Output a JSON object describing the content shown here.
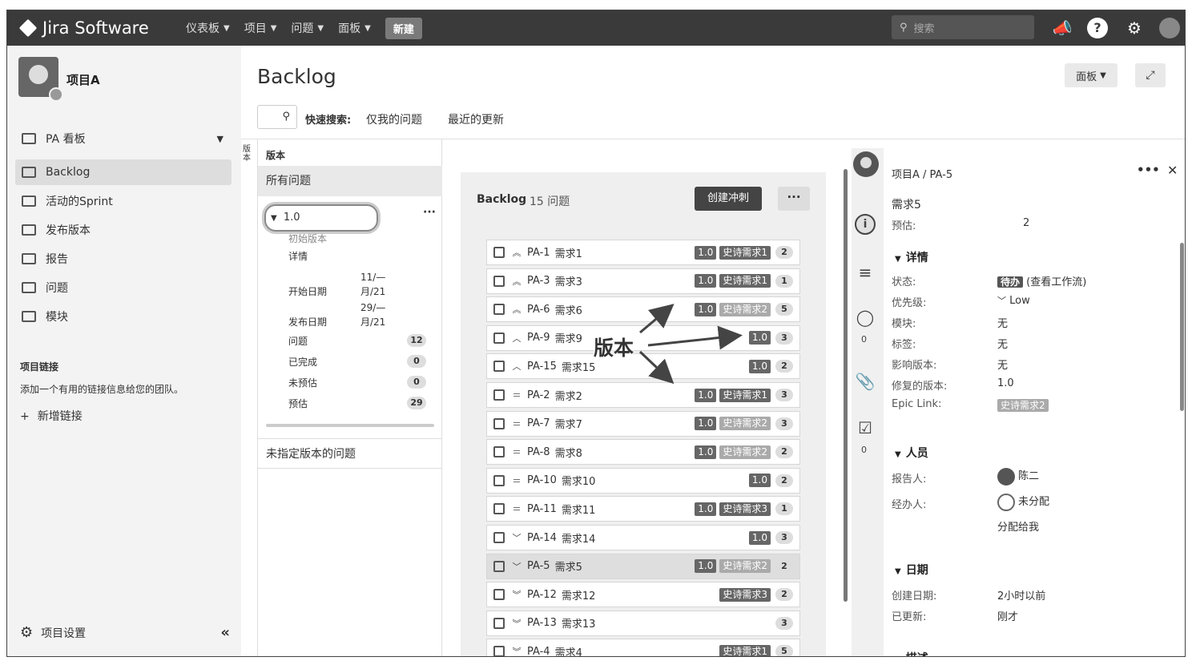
{
  "topbar": {
    "logo": "Jira Software",
    "nav": [
      "仪表板",
      "项目",
      "问题",
      "面板"
    ],
    "create": "新建",
    "search_placeholder": "搜索"
  },
  "sidebar": {
    "project_name": "项目A",
    "items": [
      {
        "label": "PA 看板",
        "icon": "board-icon"
      },
      {
        "label": "Backlog",
        "icon": "backlog-icon"
      },
      {
        "label": "活动的Sprint",
        "icon": "sprint-icon"
      },
      {
        "label": "发布版本",
        "icon": "ship-icon"
      },
      {
        "label": "报告",
        "icon": "chart-icon"
      },
      {
        "label": "问题",
        "icon": "issues-icon"
      },
      {
        "label": "模块",
        "icon": "component-icon"
      }
    ],
    "links_title": "项目链接",
    "links_desc": "添加一个有用的链接信息给您的团队。",
    "add_link": "新增链接",
    "settings": "项目设置"
  },
  "main": {
    "title": "Backlog",
    "board_btn": "面板",
    "quick_search_label": "快速搜索:",
    "quick_filters": [
      "仅我的问题",
      "最近的更新"
    ]
  },
  "versions": {
    "strip": "版本",
    "head": "版本",
    "all_issues": "所有问题",
    "version": "1.0",
    "sub_title": "初始版本",
    "details_link": "详情",
    "start_label": "开始日期",
    "start_val_1": "11/—",
    "start_val_2": "月/21",
    "release_label": "发布日期",
    "release_val_1": "29/—",
    "release_val_2": "月/21",
    "stats": [
      {
        "label": "问题",
        "value": "12"
      },
      {
        "label": "已完成",
        "value": "0"
      },
      {
        "label": "未预估",
        "value": "0"
      },
      {
        "label": "预估",
        "value": "29"
      }
    ],
    "unassigned": "未指定版本的问题"
  },
  "backlog": {
    "title": "Backlog",
    "count": "15 问题",
    "create_sprint": "创建冲刺",
    "annotation": "版本",
    "issues": [
      {
        "key": "PA-1",
        "summary": "需求1",
        "priority": "high",
        "version": "1.0",
        "epic": "史诗需求1",
        "epic_style": "dark",
        "estimate": "2"
      },
      {
        "key": "PA-3",
        "summary": "需求3",
        "priority": "high",
        "version": "1.0",
        "epic": "史诗需求1",
        "epic_style": "dark",
        "estimate": "1"
      },
      {
        "key": "PA-6",
        "summary": "需求6",
        "priority": "high",
        "version": "1.0",
        "epic": "史诗需求2",
        "epic_style": "light",
        "estimate": "5"
      },
      {
        "key": "PA-9",
        "summary": "需求9",
        "priority": "medium-high",
        "version": "1.0",
        "epic": "",
        "epic_style": "",
        "estimate": "3"
      },
      {
        "key": "PA-15",
        "summary": "需求15",
        "priority": "medium-high",
        "version": "1.0",
        "epic": "",
        "epic_style": "",
        "estimate": "2"
      },
      {
        "key": "PA-2",
        "summary": "需求2",
        "priority": "medium",
        "version": "1.0",
        "epic": "史诗需求1",
        "epic_style": "dark",
        "estimate": "3"
      },
      {
        "key": "PA-7",
        "summary": "需求7",
        "priority": "medium",
        "version": "1.0",
        "epic": "史诗需求2",
        "epic_style": "light",
        "estimate": "3"
      },
      {
        "key": "PA-8",
        "summary": "需求8",
        "priority": "medium",
        "version": "1.0",
        "epic": "史诗需求2",
        "epic_style": "light",
        "estimate": "2"
      },
      {
        "key": "PA-10",
        "summary": "需求10",
        "priority": "medium",
        "version": "1.0",
        "epic": "",
        "epic_style": "",
        "estimate": "2"
      },
      {
        "key": "PA-11",
        "summary": "需求11",
        "priority": "medium",
        "version": "1.0",
        "epic": "史诗需求3",
        "epic_style": "dark",
        "estimate": "1"
      },
      {
        "key": "PA-14",
        "summary": "需求14",
        "priority": "low",
        "version": "1.0",
        "epic": "",
        "epic_style": "",
        "estimate": "3"
      },
      {
        "key": "PA-5",
        "summary": "需求5",
        "priority": "low",
        "version": "1.0",
        "epic": "史诗需求2",
        "epic_style": "light",
        "estimate": "2",
        "selected": true
      },
      {
        "key": "PA-12",
        "summary": "需求12",
        "priority": "lowest",
        "version": "",
        "epic": "史诗需求3",
        "epic_style": "dark",
        "estimate": "2"
      },
      {
        "key": "PA-13",
        "summary": "需求13",
        "priority": "lowest",
        "version": "",
        "epic": "",
        "epic_style": "",
        "estimate": "3"
      },
      {
        "key": "PA-4",
        "summary": "需求4",
        "priority": "lowest",
        "version": "",
        "epic": "史诗需求1",
        "epic_style": "dark",
        "estimate": "5"
      }
    ]
  },
  "detail": {
    "breadcrumb": "项目A / PA-5",
    "summary": "需求5",
    "estimate_label": "预估:",
    "estimate_value": "2",
    "comments_count": "0",
    "checklist_count": "0",
    "details_section": "详情",
    "status_label": "状态:",
    "status_badge": "待办",
    "status_link": "(查看工作流)",
    "priority_label": "优先级:",
    "priority_value": "Low",
    "component_label": "模块:",
    "component_value": "无",
    "labels_label": "标签:",
    "labels_value": "无",
    "affects_label": "影响版本:",
    "affects_value": "无",
    "fix_label": "修复的版本:",
    "fix_value": "1.0",
    "epic_label": "Epic Link:",
    "epic_value": "史诗需求2",
    "people_section": "人员",
    "reporter_label": "报告人:",
    "reporter_value": "陈二",
    "assignee_label": "经办人:",
    "assignee_value": "未分配",
    "assign_me": "分配给我",
    "dates_section": "日期",
    "created_label": "创建日期:",
    "created_value": "2小时以前",
    "updated_label": "已更新:",
    "updated_value": "刚才",
    "desc_section": "描述"
  }
}
